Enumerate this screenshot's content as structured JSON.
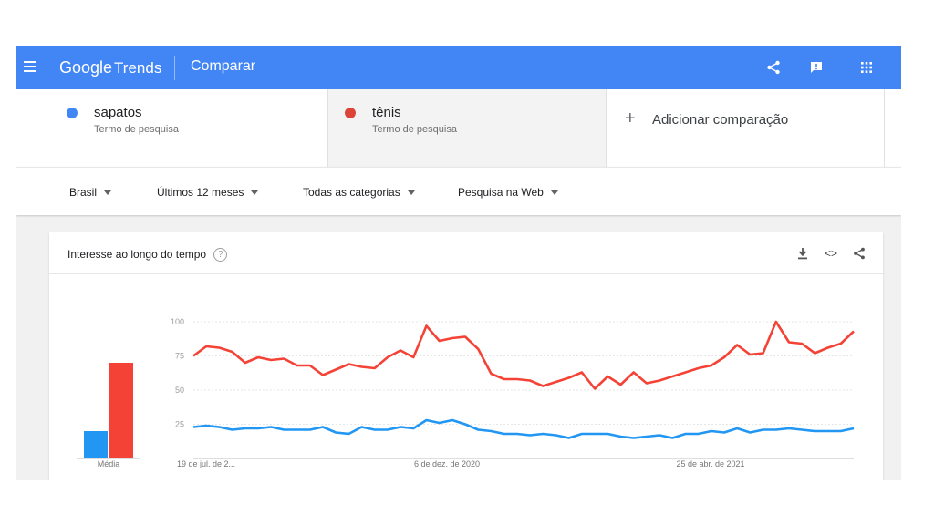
{
  "header": {
    "logo_google": "Google",
    "logo_trends": "Trends",
    "title": "Comparar",
    "icons": [
      "menu-icon",
      "share-icon",
      "feedback-icon",
      "apps-grid-icon"
    ],
    "color": "#4285f4"
  },
  "terms": [
    {
      "name": "sapatos",
      "subtitle": "Termo de pesquisa",
      "color": "#4285f4"
    },
    {
      "name": "tênis",
      "subtitle": "Termo de pesquisa",
      "color": "#db4437"
    }
  ],
  "add_comparison": {
    "icon": "+",
    "label": "Adicionar comparação"
  },
  "filters": {
    "region": "Brasil",
    "period": "Últimos 12 meses",
    "category": "Todas as categorias",
    "search_type": "Pesquisa na Web"
  },
  "card": {
    "title": "Interesse ao longo do tempo",
    "help": "?",
    "actions": [
      "download-icon",
      "embed-icon",
      "share-icon"
    ],
    "embed_glyph": "<>"
  },
  "chart_data": {
    "type": "line",
    "y_ticks": [
      "100",
      "75",
      "50",
      "25"
    ],
    "ylim": [
      0,
      100
    ],
    "x_tick_labels": [
      "19 de jul. de 2...",
      "6 de dez. de 2020",
      "25 de abr. de 2021"
    ],
    "average_label": "Média",
    "averages": [
      {
        "term": "sapatos",
        "value": 20,
        "color": "#2196f3"
      },
      {
        "term": "tênis",
        "value": 70,
        "color": "#f44336"
      }
    ],
    "series": [
      {
        "name": "tênis",
        "color": "#f44336",
        "values": [
          75,
          82,
          81,
          78,
          70,
          74,
          72,
          73,
          68,
          68,
          61,
          65,
          69,
          67,
          66,
          74,
          79,
          74,
          97,
          86,
          88,
          89,
          80,
          62,
          58,
          58,
          57,
          53,
          56,
          59,
          63,
          51,
          60,
          54,
          63,
          55,
          57,
          60,
          63,
          66,
          68,
          74,
          83,
          76,
          77,
          100,
          85,
          84,
          77,
          81,
          84,
          93
        ]
      },
      {
        "name": "sapatos",
        "color": "#2196f3",
        "values": [
          23,
          24,
          23,
          21,
          22,
          22,
          23,
          21,
          21,
          21,
          23,
          19,
          18,
          23,
          21,
          21,
          23,
          22,
          28,
          26,
          28,
          25,
          21,
          20,
          18,
          18,
          17,
          18,
          17,
          15,
          18,
          18,
          18,
          16,
          15,
          16,
          17,
          15,
          18,
          18,
          20,
          19,
          22,
          19,
          21,
          21,
          22,
          21,
          20,
          20,
          20,
          22
        ]
      }
    ]
  }
}
